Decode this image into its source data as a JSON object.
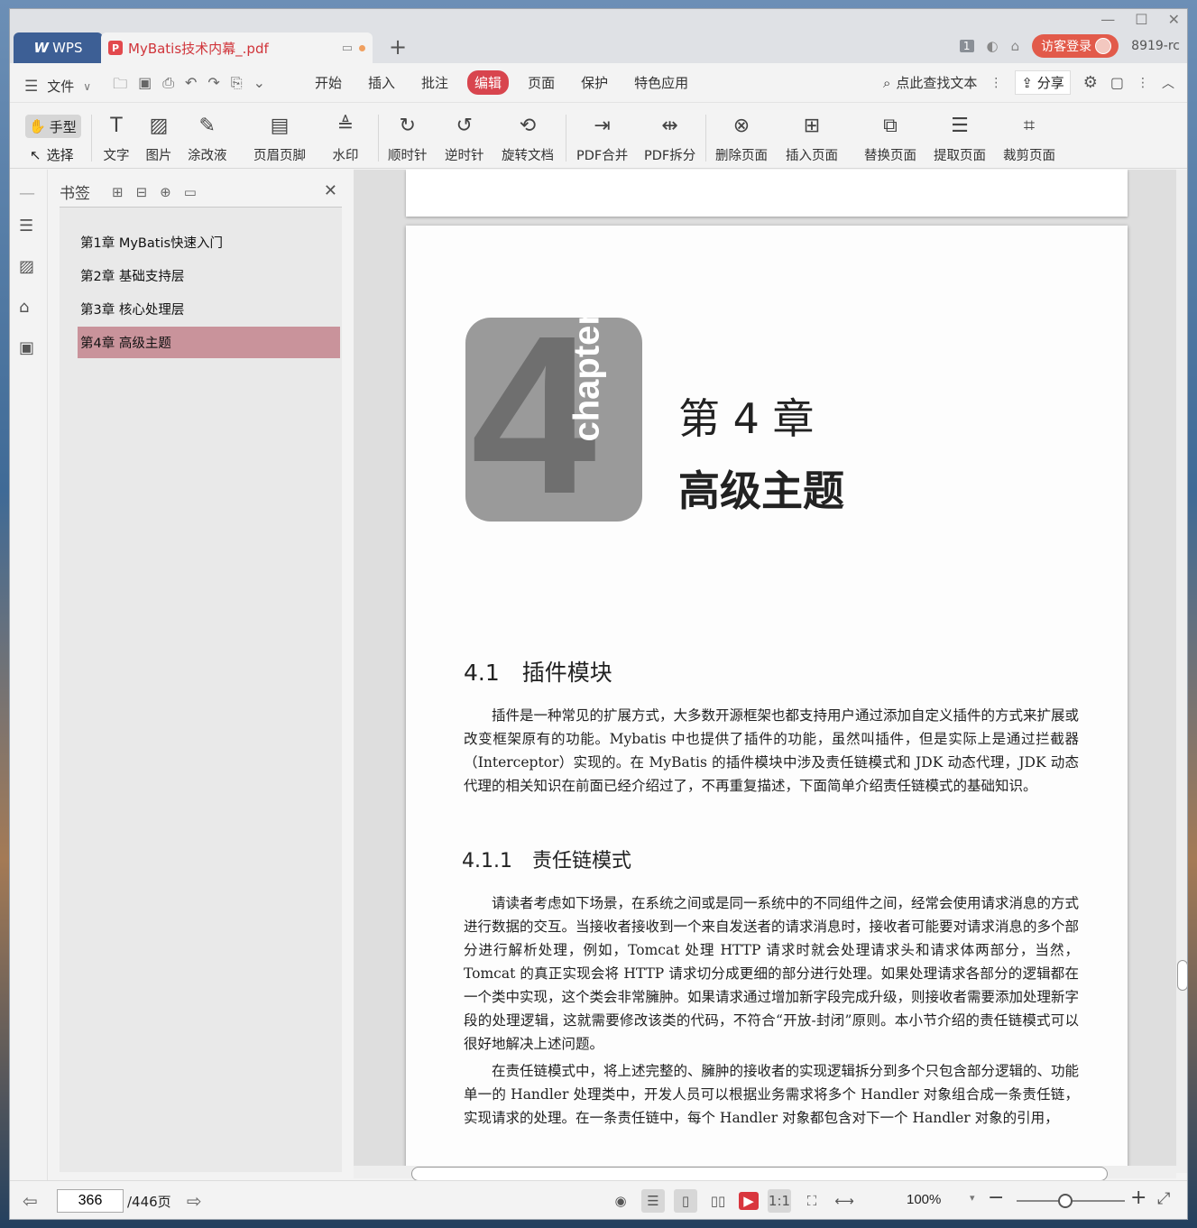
{
  "app": {
    "brand": "WPS",
    "document_tab": "MyBatis技术内幕_.pdf",
    "new_tab_symbol": "+",
    "page_badge": "1",
    "visitor_login": "访客登录",
    "user_id": "8919-rc"
  },
  "menu": {
    "file": "文件",
    "tabs": [
      {
        "label": "开始"
      },
      {
        "label": "插入"
      },
      {
        "label": "批注"
      },
      {
        "label": "编辑",
        "active": true
      },
      {
        "label": "页面"
      },
      {
        "label": "保护"
      },
      {
        "label": "特色应用"
      }
    ],
    "search": "点此查找文本",
    "share": "分享"
  },
  "ribbon": {
    "hand": "手型",
    "select": "选择",
    "buttons": [
      {
        "label": "文字",
        "icon": "text-icon"
      },
      {
        "label": "图片",
        "icon": "image-icon"
      },
      {
        "label": "涂改液",
        "icon": "correction-fluid-icon"
      },
      {
        "label": "页眉页脚",
        "icon": "header-footer-icon"
      },
      {
        "label": "水印",
        "icon": "watermark-icon"
      },
      {
        "label": "顺时针",
        "icon": "rotate-cw-icon"
      },
      {
        "label": "逆时针",
        "icon": "rotate-ccw-icon"
      },
      {
        "label": "旋转文档",
        "icon": "rotate-doc-icon"
      },
      {
        "label": "PDF合并",
        "icon": "pdf-merge-icon"
      },
      {
        "label": "PDF拆分",
        "icon": "pdf-split-icon"
      },
      {
        "label": "删除页面",
        "icon": "delete-page-icon"
      },
      {
        "label": "插入页面",
        "icon": "insert-page-icon"
      },
      {
        "label": "替换页面",
        "icon": "replace-page-icon"
      },
      {
        "label": "提取页面",
        "icon": "extract-page-icon"
      },
      {
        "label": "裁剪页面",
        "icon": "crop-page-icon"
      }
    ]
  },
  "bookmarks": {
    "title": "书签",
    "items": [
      {
        "label": "第1章 MyBatis快速入门"
      },
      {
        "label": "第2章 基础支持层"
      },
      {
        "label": "第3章 核心处理层"
      },
      {
        "label": "第4章 高级主题",
        "selected": true
      }
    ]
  },
  "document": {
    "chapter_number": "4",
    "chapter_word": "chapter",
    "chapter_title": "第 4 章",
    "chapter_subtitle": "高级主题",
    "section_title": "4.1　插件模块",
    "section_para": "插件是一种常见的扩展方式，大多数开源框架也都支持用户通过添加自定义插件的方式来扩展或改变框架原有的功能。Mybatis 中也提供了插件的功能，虽然叫插件，但是实际上是通过拦截器（Interceptor）实现的。在 MyBatis 的插件模块中涉及责任链模式和 JDK 动态代理，JDK 动态代理的相关知识在前面已经介绍过了，不再重复描述，下面简单介绍责任链模式的基础知识。",
    "subsection_title": "4.1.1　责任链模式",
    "para1": "请读者考虑如下场景，在系统之间或是同一系统中的不同组件之间，经常会使用请求消息的方式进行数据的交互。当接收者接收到一个来自发送者的请求消息时，接收者可能要对请求消息的多个部分进行解析处理，例如，Tomcat 处理 HTTP 请求时就会处理请求头和请求体两部分，当然，Tomcat 的真正实现会将 HTTP 请求切分成更细的部分进行处理。如果处理请求各部分的逻辑都在一个类中实现，这个类会非常臃肿。如果请求通过增加新字段完成升级，则接收者需要添加处理新字段的处理逻辑，这就需要修改该类的代码，不符合“开放-封闭”原则。本小节介绍的责任链模式可以很好地解决上述问题。",
    "para2": "在责任链模式中，将上述完整的、臃肿的接收者的实现逻辑拆分到多个只包含部分逻辑的、功能单一的 Handler 处理类中，开发人员可以根据业务需求将多个 Handler 对象组合成一条责任链，实现请求的处理。在一条责任链中，每个 Handler 对象都包含对下一个 Handler 对象的引用，"
  },
  "status": {
    "current_page": "366",
    "total_pages": "/446页",
    "zoom": "100%"
  },
  "colors": {
    "accent": "#d8454e",
    "wps_tab": "#3d5f95",
    "bookmark_selected": "#c9939b"
  }
}
